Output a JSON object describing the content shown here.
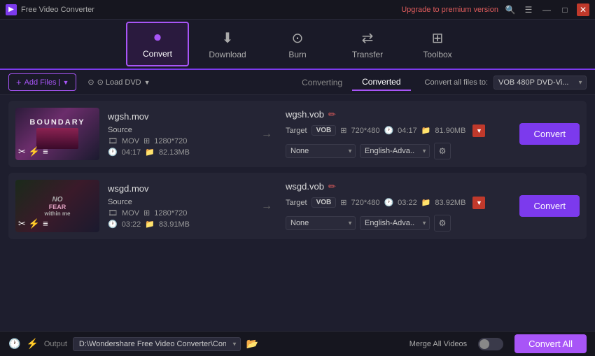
{
  "app": {
    "title": "Free Video Converter",
    "upgrade_label": "Upgrade to premium version"
  },
  "titlebar": {
    "search_icon": "🔍",
    "menu_icon": "☰",
    "minimize_icon": "—",
    "maximize_icon": "□",
    "close_icon": "✕"
  },
  "nav": {
    "items": [
      {
        "id": "convert",
        "label": "Convert",
        "icon": "▶",
        "active": true
      },
      {
        "id": "download",
        "label": "Download",
        "icon": "⬇",
        "active": false
      },
      {
        "id": "burn",
        "label": "Burn",
        "icon": "⊙",
        "active": false
      },
      {
        "id": "transfer",
        "label": "Transfer",
        "icon": "⇄",
        "active": false
      },
      {
        "id": "toolbox",
        "label": "Toolbox",
        "icon": "⊞",
        "active": false
      }
    ]
  },
  "actionbar": {
    "add_files_label": "+ Add Files",
    "load_dvd_label": "⊙ Load DVD",
    "tab_converting": "Converting",
    "tab_converted": "Converted",
    "convert_all_files_label": "Convert all files to:",
    "format_value": "VOB 480P DVD-Vi..."
  },
  "files": [
    {
      "id": "file1",
      "source_name": "wgsh.mov",
      "target_name": "wgsh.vob",
      "source": {
        "format": "MOV",
        "resolution": "1280*720",
        "duration": "04:17",
        "size": "82.13MB"
      },
      "target": {
        "format": "VOB",
        "resolution": "720*480",
        "duration": "04:17",
        "size": "81.90MB"
      },
      "subtitle": "None",
      "audio": "English-Adva...",
      "thumb_type": "boundary"
    },
    {
      "id": "file2",
      "source_name": "wsgd.mov",
      "target_name": "wsgd.vob",
      "source": {
        "format": "MOV",
        "resolution": "1280*720",
        "duration": "03:22",
        "size": "83.91MB"
      },
      "target": {
        "format": "VOB",
        "resolution": "720*480",
        "duration": "03:22",
        "size": "83.92MB"
      },
      "subtitle": "None",
      "audio": "English-Adva...",
      "thumb_type": "fear"
    }
  ],
  "bottombar": {
    "output_label": "Output",
    "output_path": "D:\\Wondershare Free Video Converter\\Converted",
    "merge_label": "Merge All Videos",
    "convert_all_btn": "Convert All"
  },
  "convert_btn_label": "Convert"
}
